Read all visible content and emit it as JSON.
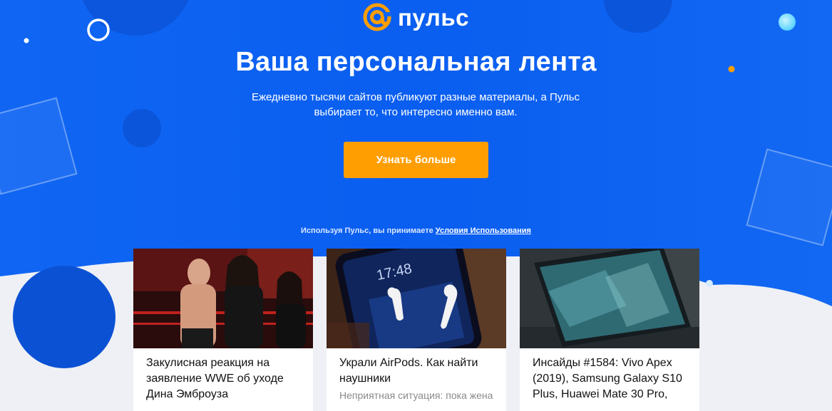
{
  "header": {
    "brand_name": "пульс",
    "title": "Ваша персональная лента",
    "subtitle_line1": "Ежедневно тысячи сайтов публикуют разные материалы, а Пульс",
    "subtitle_line2": "выбирает то, что интересно именно вам.",
    "cta_label": "Узнать больше",
    "terms_prefix": "Используя Пульс, вы принимаете",
    "terms_link": "Условия Использования"
  },
  "colors": {
    "hero_blue": "#0f63ef",
    "accent_orange": "#ff9e00",
    "page_bg": "#eef0f5"
  },
  "cards": [
    {
      "title": "Закулисная реакция на заявление WWE об уходе Дина Эмброуза",
      "snippet": "",
      "image": "wrestling-ring-photo"
    },
    {
      "title": "Украли AirPods. Как найти наушники",
      "snippet": "Неприятная ситуация: пока жена",
      "image": "airpods-on-phone-photo",
      "phone_time": "17:48"
    },
    {
      "title": "Инсайды #1584: Vivo Apex (2019), Samsung Galaxy S10 Plus, Huawei Mate 30 Pro,",
      "snippet": "",
      "image": "smartphone-on-table-photo"
    }
  ]
}
